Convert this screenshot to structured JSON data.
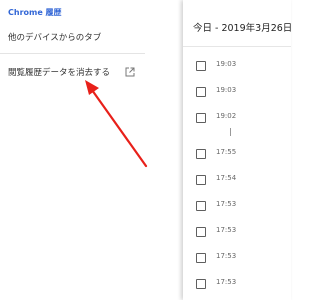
{
  "sidebar": {
    "title": "Chrome 履歴",
    "items": [
      {
        "label": "他のデバイスからのタブ"
      },
      {
        "label": "閲覧履歴データを消去する"
      }
    ]
  },
  "main": {
    "header": "今日 - 2019年3月26日火",
    "entries": [
      {
        "time": "19:03"
      },
      {
        "time": "19:03"
      },
      {
        "time": "19:02"
      },
      {
        "time": "17:55"
      },
      {
        "time": "17:54"
      },
      {
        "time": "17:53"
      },
      {
        "time": "17:53"
      },
      {
        "time": "17:53"
      },
      {
        "time": "17:53"
      }
    ]
  },
  "annotation": {
    "color": "#e8201a"
  }
}
